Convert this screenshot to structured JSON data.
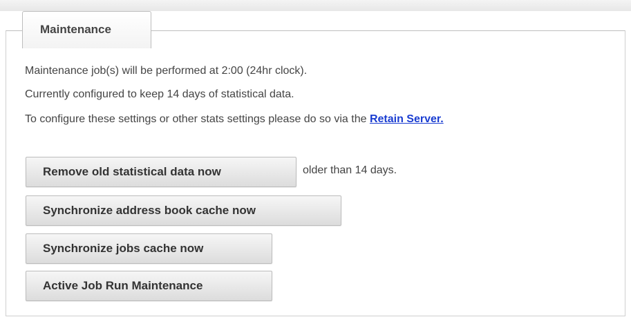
{
  "tab": {
    "label": "Maintenance"
  },
  "info": {
    "line1": "Maintenance job(s) will be performed at 2:00 (24hr clock).",
    "line2": "Currently configured to keep 14 days of statistical data.",
    "line3_prefix": "To configure these settings or other stats settings please do so via the ",
    "line3_link": "Retain Server."
  },
  "actions": {
    "remove_old": "Remove old statistical data now",
    "remove_old_suffix": "older than 14 days.",
    "sync_address_book": "Synchronize address book cache now",
    "sync_jobs": "Synchronize jobs cache now",
    "active_job_run": "Active Job Run Maintenance"
  }
}
